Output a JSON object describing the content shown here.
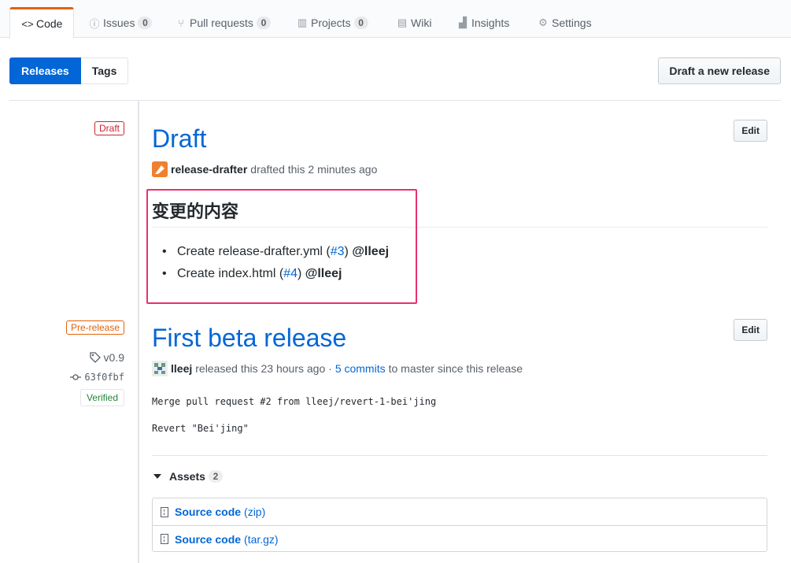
{
  "tabs": [
    {
      "label": "Code",
      "icon": "code-icon",
      "glyph": "<>"
    },
    {
      "label": "Issues",
      "icon": "issue-icon",
      "glyph": "ⓘ",
      "count": "0"
    },
    {
      "label": "Pull requests",
      "icon": "pull-request-icon",
      "glyph": "⑂",
      "count": "0"
    },
    {
      "label": "Projects",
      "icon": "project-icon",
      "glyph": "▥",
      "count": "0"
    },
    {
      "label": "Wiki",
      "icon": "book-icon",
      "glyph": "▤"
    },
    {
      "label": "Insights",
      "icon": "graph-icon",
      "glyph": "▟"
    },
    {
      "label": "Settings",
      "icon": "gear-icon",
      "glyph": "⚙"
    }
  ],
  "subnav": {
    "releases": "Releases",
    "tags": "Tags",
    "draft_button": "Draft a new release"
  },
  "draft": {
    "label": "Draft",
    "title": "Draft",
    "edit": "Edit",
    "author": "release-drafter",
    "action": "drafted this 2 minutes ago",
    "heading": "变更的内容",
    "notes": [
      {
        "pre": "Create release-drafter.yml (",
        "link": "#3",
        "post": ")",
        "user": "@lleej"
      },
      {
        "pre": "Create index.html (",
        "link": "#4",
        "post": ")",
        "user": "@lleej"
      }
    ]
  },
  "beta": {
    "label": "Pre-release",
    "tag": "v0.9",
    "commit": "63f0fbf",
    "verified": "Verified",
    "title": "First beta release",
    "edit": "Edit",
    "author": "lleej",
    "action": "released this 23 hours ago ·",
    "commits": "5 commits",
    "commits_suffix": "to master since this release",
    "message_line1": "Merge pull request #2 from lleej/revert-1-bei'jing",
    "message_line2": "Revert \"Bei'jing\"",
    "assets_label": "Assets",
    "assets_count": "2",
    "assets": [
      {
        "name": "Source code",
        "ext": "(zip)"
      },
      {
        "name": "Source code",
        "ext": "(tar.gz)"
      }
    ]
  },
  "colors": {
    "accent": "#0366d6",
    "tab_active": "#e36209",
    "highlight": "#e8316f"
  }
}
